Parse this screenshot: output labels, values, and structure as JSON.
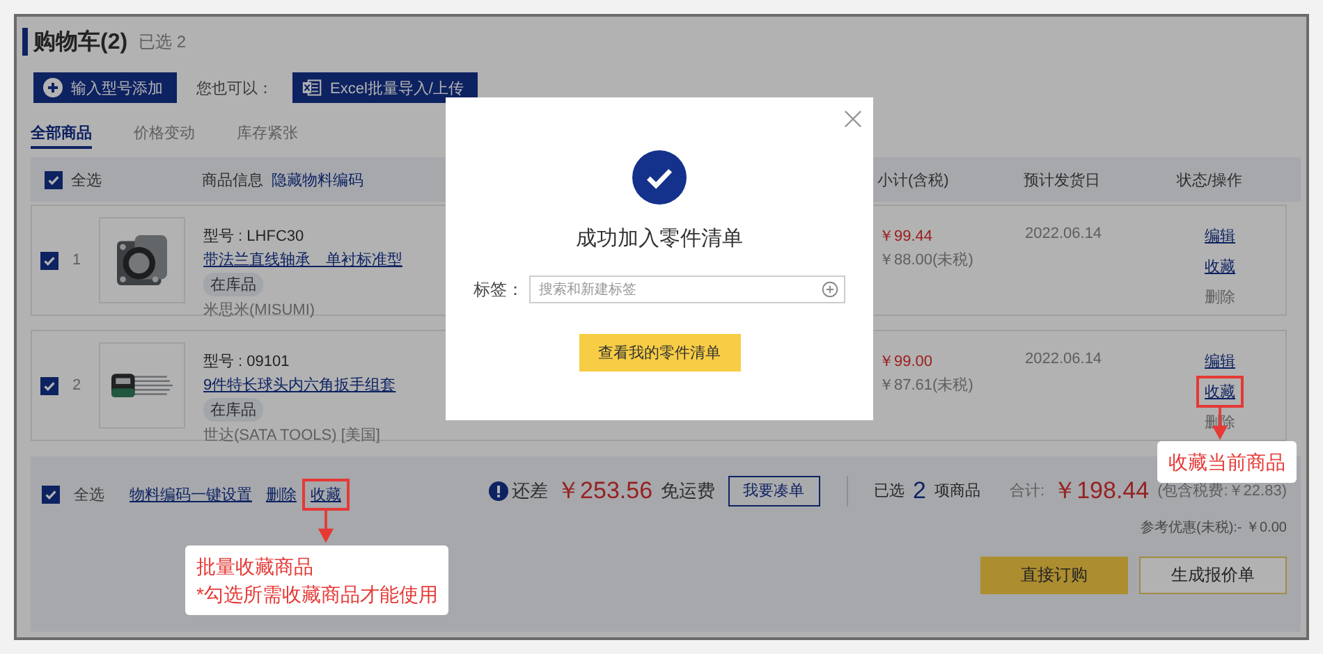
{
  "cart": {
    "title": "购物车(2)",
    "selected_info": "已选 2",
    "add_button": "输入型号添加",
    "also_label": "您也可以：",
    "import_button": "Excel批量导入/上传"
  },
  "tabs": [
    {
      "label": "全部商品",
      "selected": true
    },
    {
      "label": "价格变动",
      "selected": false
    },
    {
      "label": "库存紧张",
      "selected": false
    }
  ],
  "table": {
    "select_all": {
      "label": "全选",
      "checked": true
    },
    "columns": [
      {
        "label": "商品信息",
        "link": "隐藏物料编码"
      },
      {
        "label": "小计(含税)"
      },
      {
        "label": "预计发货日"
      },
      {
        "label": "状态/操作"
      }
    ],
    "rows": [
      {
        "checked": true,
        "index": "1",
        "model": "型号 : LHFC30",
        "name": "带法兰直线轴承　单衬标准型",
        "stock": "在库品",
        "brand": "米思米(MISUMI)",
        "price_tax": "￥99.44",
        "price_net": "￥88.00(未税)",
        "ship_date": "2022.06.14",
        "actions": [
          {
            "label": "编辑",
            "kind": "link"
          },
          {
            "label": "收藏",
            "kind": "link"
          },
          {
            "label": "删除",
            "kind": "text"
          }
        ]
      },
      {
        "checked": true,
        "index": "2",
        "model": "型号 : 09101",
        "name": "9件特长球头内六角扳手组套",
        "stock": "在库品",
        "brand": "世达(SATA TOOLS) [美国]",
        "price_tax": "￥99.00",
        "price_net": "￥87.61(未税)",
        "ship_date": "2022.06.14",
        "actions": [
          {
            "label": "编辑",
            "kind": "link"
          },
          {
            "label": "收藏",
            "kind": "link",
            "callout": [
              "收藏当前商品"
            ]
          },
          {
            "label": "删除",
            "kind": "text"
          }
        ]
      }
    ]
  },
  "footer": {
    "select_all": {
      "label": "全选",
      "checked": true
    },
    "actions": [
      {
        "label": "物料编码一键设置"
      },
      {
        "label": "删除"
      },
      {
        "label": "收藏",
        "callout": [
          "批量收藏商品",
          "*勾选所需收藏商品才能使用"
        ]
      }
    ],
    "shortfall_label": "还差",
    "shortfall_amount": "￥253.56",
    "shortfall_suffix": "免运费",
    "combine_button": "我要凑单",
    "selected_prefix": "已选",
    "selected_count": "2",
    "selected_suffix": "项商品",
    "total_label": "合计:",
    "total_amount": "￥198.44",
    "tax_note": "(包含税费:￥22.83)",
    "discount": "参考优惠(未税):- ￥0.00",
    "buttons": [
      {
        "label": "直接订购",
        "kind": "primary"
      },
      {
        "label": "生成报价单",
        "kind": "secondary"
      }
    ]
  },
  "modal": {
    "title": "成功加入零件清单",
    "tag_label": "标签：",
    "tag_placeholder": "搜索和新建标签",
    "button": "查看我的零件清单"
  }
}
